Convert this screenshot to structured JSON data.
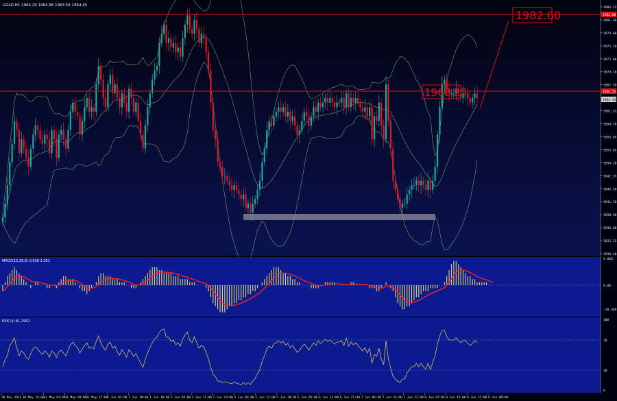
{
  "header": {
    "symbol_info": "GOLD,H1  1964.29 1964.98 1963.53 1964.45"
  },
  "colors": {
    "main_bg_top": "#03030f",
    "main_bg_bottom": "#0a1250",
    "panel_bg": "#0b1a8e",
    "axis_bg": "#000010",
    "bull": "#26a69a",
    "bear": "#d81b28",
    "bands": "#7fbf7f",
    "hline": "#e01010",
    "support_box": "#8c8c9c",
    "macd_hist": "#e6d86a",
    "macd_signal": "#ff2020",
    "rsi_line": "#d8c060"
  },
  "price_labels": {
    "target": "1982.60",
    "current": "1966.25"
  },
  "right_axis": {
    "main_ticks": [
      "1984.15",
      "1981.30",
      "1978.60",
      "1975.70",
      "1973.00",
      "1970.10",
      "1967.20",
      "1964.45",
      "1961.55",
      "1958.70",
      "1955.95",
      "1953.05",
      "1950.20",
      "1947.35",
      "1944.50",
      "1941.70",
      "1938.90",
      "1936.00",
      "1933.25",
      "1930.40"
    ],
    "main_tags": [
      "1982.60",
      "1966.25",
      "1964.45"
    ],
    "macd_ticks": [
      "5.066",
      "0.00",
      "-10.489"
    ],
    "rsi_ticks": [
      "100",
      "70",
      "30",
      "0"
    ]
  },
  "macd_panel": {
    "label": "MACD(12,26,9) 0.536 2.281"
  },
  "rsi_panel": {
    "label": "RSI(14) 61.2952"
  },
  "time_axis": [
    "30 May 2023",
    "30 May 16:00",
    "31 May 01:00",
    "31 May 09:00",
    "31 May 17:00",
    "1 Jun 02:00",
    "1 Jun 10:00",
    "1 Jun 18:00",
    "2 Jun 03:00",
    "2 Jun 11:00",
    "2 Jun 19:00",
    "5 Jun 04:00",
    "5 Jun 12:00",
    "5 Jun 20:00",
    "6 Jun 05:00",
    "6 Jun 13:00",
    "6 Jun 21:00",
    "7 Jun 06:00",
    "7 Jun 14:00",
    "7 Jun 22:00",
    "8 Jun 07:00",
    "8 Jun 15:00",
    "8 Jun 23:00",
    "9 Jun 08:00"
  ],
  "series": {
    "closes": [
      1938,
      1941,
      1945,
      1950,
      1954,
      1959,
      1957,
      1952,
      1955,
      1953,
      1951,
      1949,
      1953,
      1956,
      1958,
      1957,
      1955,
      1954,
      1956,
      1955,
      1952,
      1957,
      1955,
      1951,
      1956,
      1957,
      1955,
      1953,
      1957,
      1961,
      1963,
      1961,
      1960,
      1956,
      1959,
      1962,
      1964,
      1961,
      1962,
      1961,
      1967,
      1971,
      1968,
      1964,
      1962,
      1967,
      1969,
      1965,
      1967,
      1964,
      1962,
      1965,
      1963,
      1961,
      1966,
      1964,
      1961,
      1963,
      1959,
      1956,
      1953,
      1958,
      1962,
      1965,
      1968,
      1970,
      1971,
      1976,
      1978,
      1980,
      1976,
      1977,
      1975,
      1976,
      1974,
      1975,
      1973,
      1977,
      1980,
      1982,
      1979,
      1978,
      1981,
      1979,
      1976,
      1978,
      1977,
      1974,
      1970,
      1963,
      1957,
      1955,
      1950,
      1949,
      1947,
      1947,
      1946,
      1945,
      1944,
      1945,
      1944,
      1943,
      1942,
      1943,
      1940,
      1941,
      1939,
      1941,
      1942,
      1944,
      1946,
      1950,
      1953,
      1957,
      1959,
      1958,
      1960,
      1961,
      1962,
      1961,
      1962,
      1960,
      1961,
      1959,
      1960,
      1958,
      1956,
      1957,
      1959,
      1961,
      1960,
      1958,
      1960,
      1962,
      1961,
      1963,
      1962,
      1963,
      1964,
      1963,
      1964,
      1963,
      1962,
      1963,
      1963,
      1964,
      1962,
      1965,
      1962,
      1964,
      1963,
      1964,
      1963,
      1962,
      1961,
      1962,
      1960,
      1962,
      1955,
      1960,
      1959,
      1963,
      1958,
      1955,
      1967,
      1959,
      1953,
      1946,
      1944,
      1942,
      1940,
      1941,
      1941,
      1943,
      1944,
      1945,
      1945,
      1946,
      1945,
      1946,
      1945,
      1944,
      1946,
      1944,
      1946,
      1949,
      1956,
      1962,
      1967,
      1968,
      1966,
      1965,
      1965,
      1965,
      1966,
      1965,
      1964,
      1965,
      1965,
      1964,
      1963,
      1964,
      1965,
      1964
    ],
    "hist": [
      -2,
      1,
      3,
      4,
      5,
      6,
      5,
      4,
      3,
      2,
      1,
      0,
      -1,
      0,
      1,
      1,
      0,
      0,
      0,
      -1,
      -1,
      0,
      0,
      -1,
      1,
      2,
      3,
      3,
      2,
      2,
      2,
      1,
      0,
      -1,
      -2,
      -2,
      -3,
      -2,
      -1,
      0,
      1,
      3,
      4,
      4,
      3,
      3,
      3,
      2,
      2,
      2,
      1,
      1,
      1,
      0,
      0,
      -1,
      -1,
      -1,
      0,
      1,
      2,
      3,
      4,
      5,
      6,
      6,
      6,
      5,
      5,
      4,
      4,
      4,
      4,
      3,
      3,
      3,
      2,
      2,
      2,
      2,
      1,
      1,
      1,
      0,
      0,
      0,
      0,
      -1,
      -2,
      -4,
      -6,
      -7,
      -8,
      -9,
      -9,
      -9,
      -8,
      -7,
      -7,
      -6,
      -6,
      -5,
      -5,
      -4,
      -4,
      -3,
      -3,
      -2,
      -2,
      -1,
      0,
      1,
      2,
      3,
      4,
      5,
      6,
      6,
      6,
      5,
      4,
      4,
      3,
      3,
      2,
      2,
      1,
      1,
      0,
      0,
      0,
      0,
      -1,
      -1,
      -1,
      -1,
      0,
      0,
      1,
      1,
      1,
      1,
      1,
      0,
      0,
      0,
      0,
      0,
      0,
      1,
      1,
      0,
      0,
      0,
      0,
      0,
      0,
      -1,
      -1,
      -1,
      -2,
      -2,
      -1,
      0,
      1,
      0,
      -1,
      -2,
      -4,
      -6,
      -7,
      -8,
      -8,
      -7,
      -7,
      -6,
      -5,
      -4,
      -4,
      -3,
      -2,
      -2,
      -2,
      -1,
      -1,
      -1,
      -1,
      0,
      0,
      1,
      3,
      5,
      7,
      8,
      8,
      7,
      6,
      5,
      4,
      3,
      3,
      2,
      2,
      1,
      1,
      1,
      1,
      1,
      0,
      0,
      0
    ],
    "rsi": [
      35,
      45,
      52,
      66,
      71,
      77,
      63,
      51,
      58,
      55,
      49,
      46,
      54,
      61,
      64,
      61,
      56,
      53,
      58,
      55,
      49,
      58,
      55,
      48,
      57,
      59,
      55,
      51,
      59,
      67,
      71,
      66,
      63,
      55,
      61,
      66,
      70,
      62,
      64,
      61,
      72,
      80,
      70,
      63,
      59,
      68,
      71,
      62,
      65,
      57,
      52,
      60,
      55,
      49,
      60,
      56,
      50,
      54,
      47,
      40,
      34,
      46,
      55,
      63,
      70,
      76,
      78,
      85,
      89,
      90,
      78,
      78,
      72,
      74,
      67,
      70,
      65,
      75,
      81,
      86,
      74,
      70,
      79,
      70,
      62,
      66,
      64,
      56,
      47,
      34,
      24,
      21,
      14,
      14,
      12,
      13,
      12,
      11,
      10,
      13,
      11,
      10,
      9,
      12,
      9,
      12,
      9,
      14,
      18,
      25,
      31,
      43,
      51,
      61,
      65,
      62,
      68,
      70,
      73,
      70,
      72,
      67,
      69,
      63,
      66,
      61,
      56,
      59,
      64,
      68,
      65,
      59,
      65,
      70,
      66,
      73,
      69,
      72,
      75,
      72,
      74,
      71,
      68,
      71,
      71,
      73,
      66,
      77,
      65,
      71,
      67,
      70,
      66,
      62,
      58,
      63,
      55,
      62,
      40,
      53,
      50,
      62,
      46,
      38,
      73,
      47,
      33,
      21,
      17,
      14,
      12,
      17,
      17,
      26,
      31,
      35,
      35,
      40,
      35,
      40,
      35,
      31,
      40,
      31,
      41,
      51,
      68,
      80,
      88,
      88,
      79,
      74,
      74,
      74,
      77,
      73,
      70,
      73,
      73,
      69,
      66,
      69,
      73,
      70
    ]
  }
}
